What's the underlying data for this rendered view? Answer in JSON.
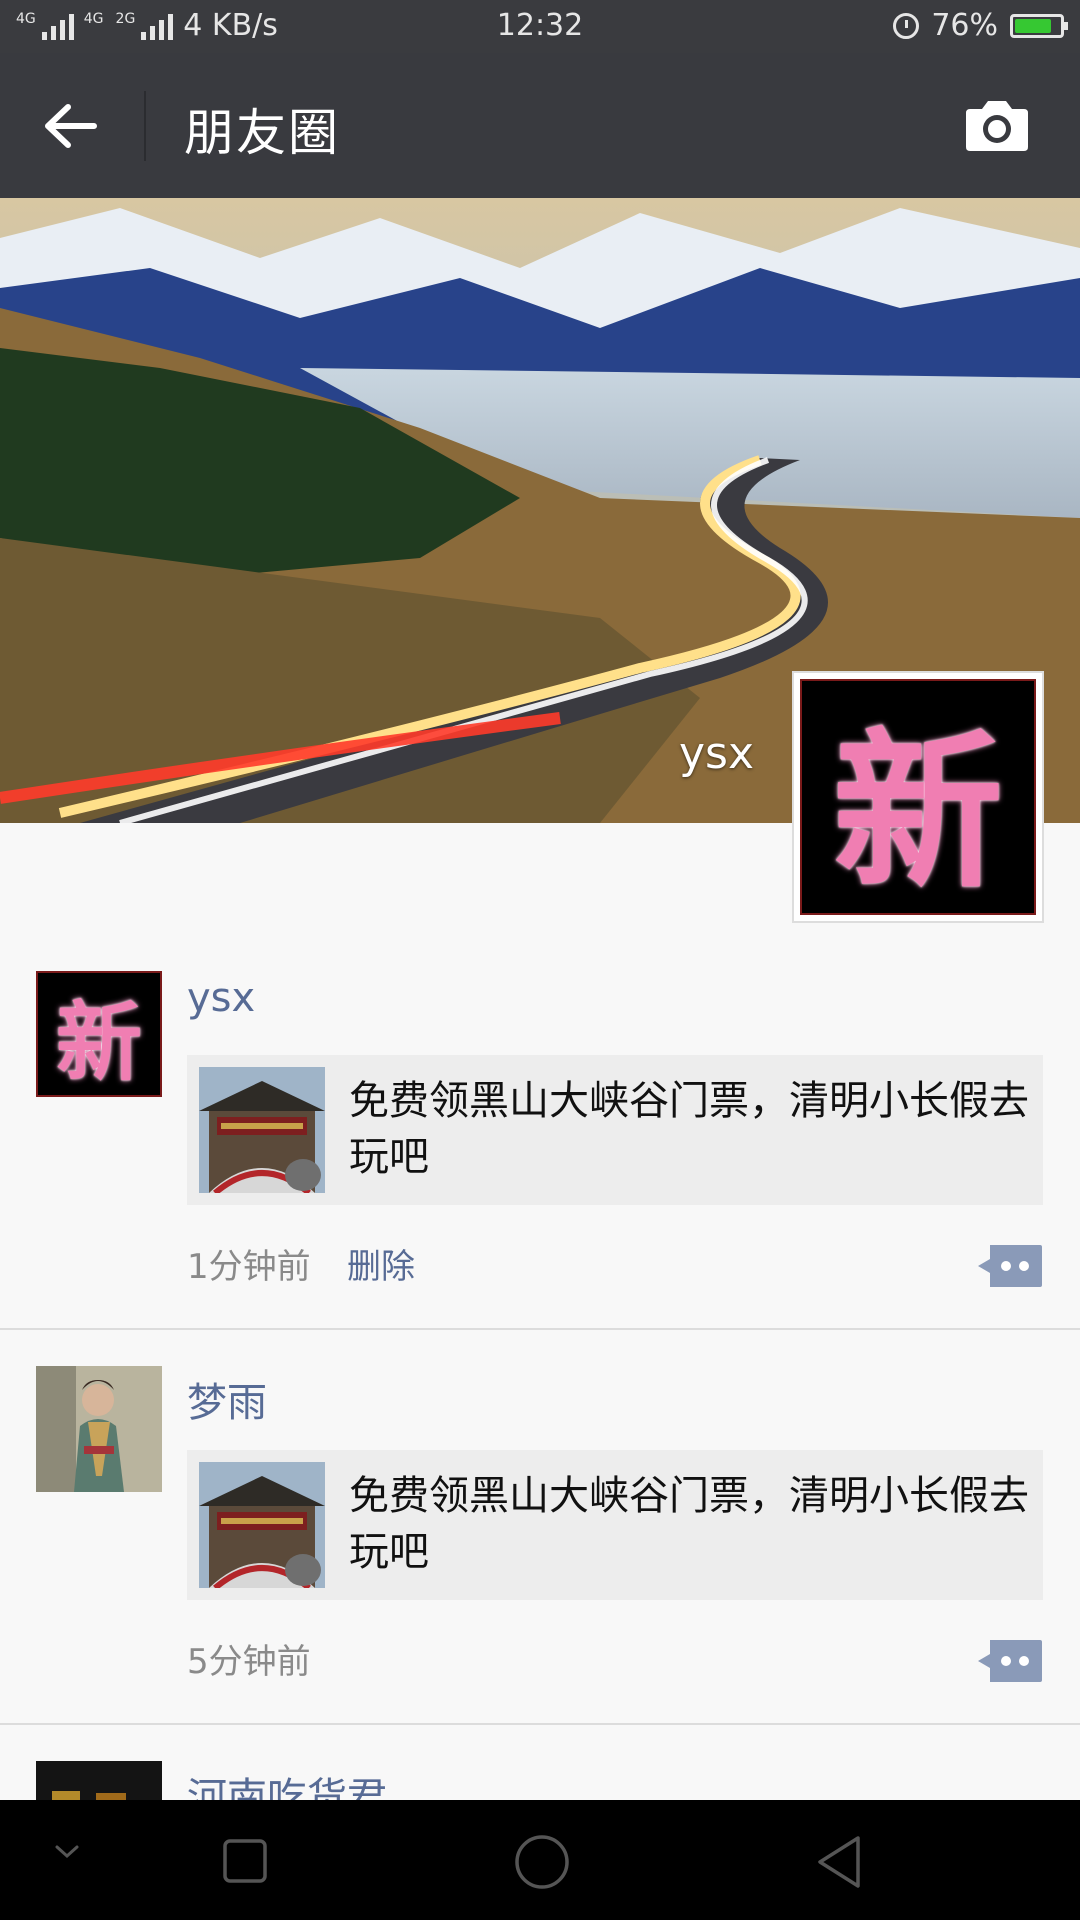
{
  "status_bar": {
    "network_labels": [
      "4G",
      "4G",
      "2G"
    ],
    "speed": "4 KB/s",
    "time": "12:32",
    "battery": "76%",
    "battery_level": 0.76
  },
  "header": {
    "title": "朋友圈",
    "back_icon": "arrow-left-icon",
    "camera_icon": "camera-icon"
  },
  "cover": {
    "user_name": "ysx",
    "avatar_char": "新"
  },
  "posts": [
    {
      "name": "ysx",
      "avatar_char": "新",
      "share_text": "免费领黑山大峡谷门票，清明小长假去玩吧",
      "time": "1分钟前",
      "delete_label": "删除"
    },
    {
      "name": "梦雨",
      "share_text": "免费领黑山大峡谷门票，清明小长假去玩吧",
      "time": "5分钟前"
    },
    {
      "name": "河南吃货君"
    }
  ],
  "colors": {
    "titlebar": "#393a3f",
    "link": "#576b95",
    "card_bg": "#ededed"
  }
}
